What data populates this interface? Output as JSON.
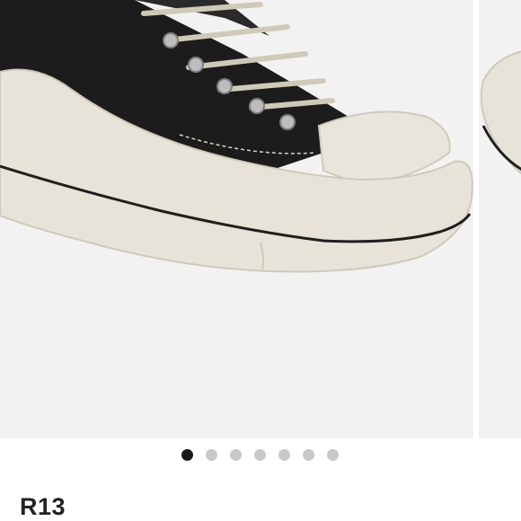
{
  "product": {
    "brand": "R13",
    "image_description_icon": "sneaker-image"
  },
  "carousel": {
    "slide_count": 7,
    "active_index": 0,
    "colors": {
      "active_dot": "#1a1a1a",
      "inactive_dot": "#c8c8c8",
      "image_background": "#f2f2f2"
    }
  }
}
